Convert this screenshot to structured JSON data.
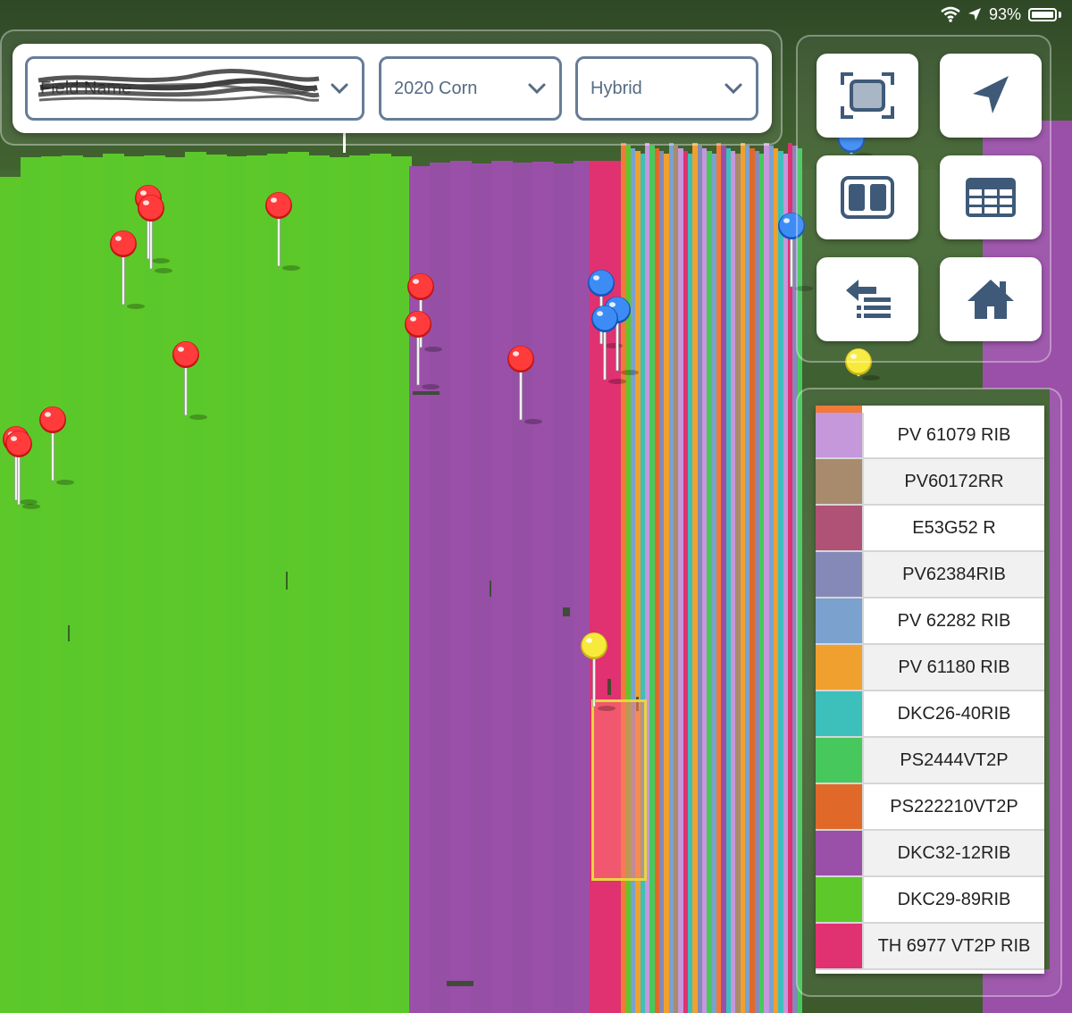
{
  "status_bar": {
    "battery_percent": "93%"
  },
  "filters": {
    "field": {
      "value": "Field Name"
    },
    "season": {
      "value": "2020 Corn"
    },
    "layer": {
      "value": "Hybrid"
    }
  },
  "toolbar": {
    "buttons": [
      {
        "icon": "fit-extent-icon"
      },
      {
        "icon": "navigate-arrow-icon"
      },
      {
        "icon": "split-view-icon"
      },
      {
        "icon": "table-icon"
      },
      {
        "icon": "swap-list-icon"
      },
      {
        "icon": "home-icon"
      }
    ]
  },
  "legend": {
    "items": [
      {
        "label": "PV 61079 RIB",
        "color": "#c597db"
      },
      {
        "label": "PV60172RR",
        "color": "#a88b6c"
      },
      {
        "label": "E53G52 R",
        "color": "#b05276"
      },
      {
        "label": "PV62384RIB",
        "color": "#8589b8"
      },
      {
        "label": "PV 62282 RIB",
        "color": "#7ba1cf"
      },
      {
        "label": "PV 61180 RIB",
        "color": "#f0a02f"
      },
      {
        "label": "DKC26-40RIB",
        "color": "#3dbfbb"
      },
      {
        "label": "PS2444VT2P",
        "color": "#47c85d"
      },
      {
        "label": "PS222210VT2P",
        "color": "#e0692a"
      },
      {
        "label": "DKC32-12RIB",
        "color": "#9a4fa8"
      },
      {
        "label": "DKC29-89RIB",
        "color": "#5dc82a"
      },
      {
        "label": "TH 6977 VT2P RIB",
        "color": "#e03171"
      }
    ]
  },
  "map": {
    "pins": [
      {
        "color": "red"
      },
      {
        "color": "red"
      },
      {
        "color": "red"
      },
      {
        "color": "red"
      },
      {
        "color": "red"
      },
      {
        "color": "red"
      },
      {
        "color": "red"
      },
      {
        "color": "red"
      },
      {
        "color": "red"
      },
      {
        "color": "red"
      },
      {
        "color": "red"
      },
      {
        "color": "blue"
      },
      {
        "color": "blue"
      },
      {
        "color": "blue"
      },
      {
        "color": "blue"
      },
      {
        "color": "blue"
      },
      {
        "color": "yellow"
      },
      {
        "color": "yellow"
      }
    ]
  }
}
